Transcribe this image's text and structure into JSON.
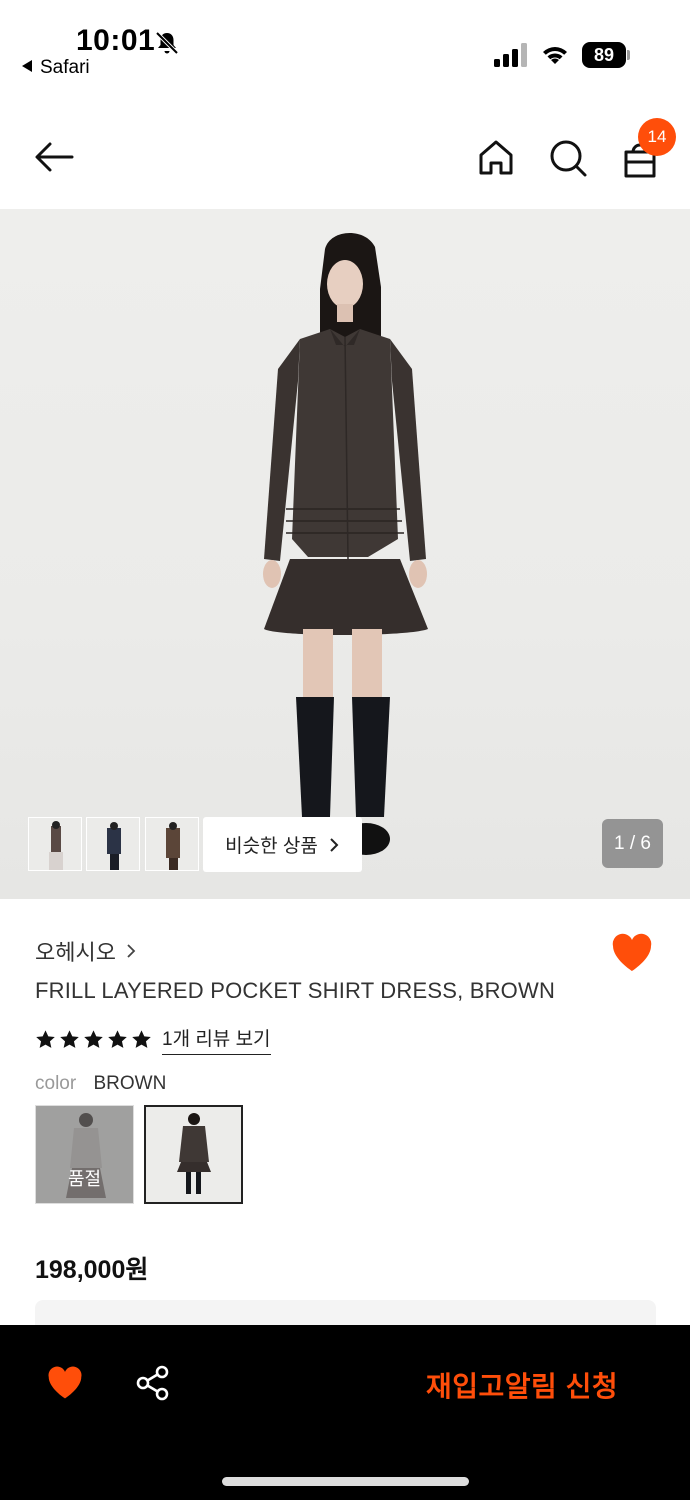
{
  "status_bar": {
    "time": "10:01",
    "back_app": "Safari",
    "battery": "89"
  },
  "header": {
    "cart_count": "14"
  },
  "gallery": {
    "similar_label": "비슷한 상품",
    "page_indicator": "1 / 6"
  },
  "product": {
    "brand": "오헤시오",
    "name": "FRILL LAYERED POCKET SHIRT DRESS, BROWN",
    "rating": 5,
    "review_link": "1개 리뷰 보기",
    "color_label": "color",
    "color_value": "BROWN",
    "soldout_label": "품절",
    "price": "198,000원"
  },
  "bottom_bar": {
    "restock_label": "재입고알림 신청"
  },
  "colors": {
    "accent": "#ff4e0a",
    "bar_bg": "#000000"
  },
  "icons": [
    "bell-off-icon",
    "signal-icon",
    "wifi-icon",
    "battery-icon",
    "back-arrow-icon",
    "home-icon",
    "search-icon",
    "shopping-bag-icon",
    "chevron-right-icon",
    "heart-icon",
    "star-icon",
    "share-icon"
  ]
}
